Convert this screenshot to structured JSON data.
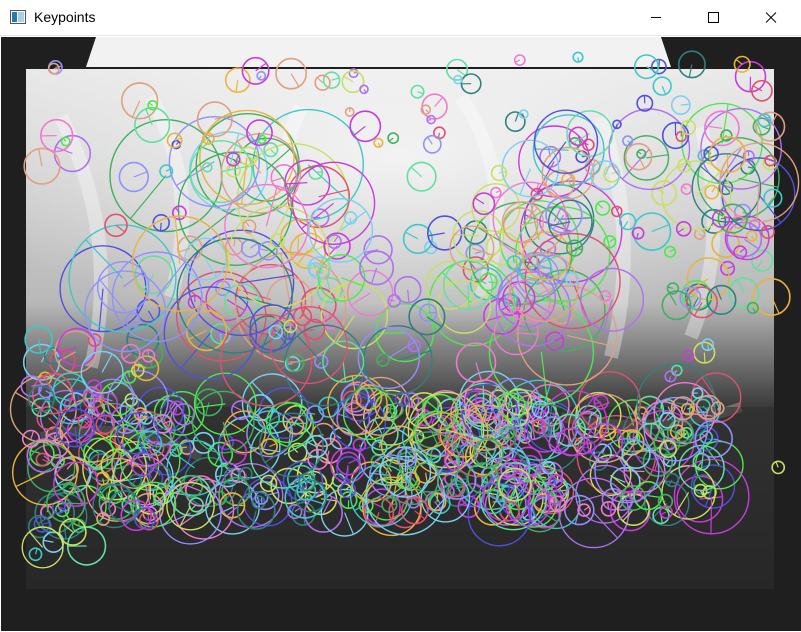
{
  "window": {
    "title": "Keypoints",
    "icon": "opencv-window-icon"
  },
  "controls": {
    "minimize_icon": "minimize-icon",
    "maximize_icon": "maximize-icon",
    "close_icon": "close-icon"
  },
  "colors": {
    "titlebar_bg": "#ffffff",
    "keypoint_palette": [
      "#4de84d",
      "#c83cdc",
      "#3cc8c8",
      "#e8b43c",
      "#5050e0",
      "#e05070",
      "#7ad0f0",
      "#b070f0",
      "#40b060",
      "#f07ad0",
      "#c8e060",
      "#308080",
      "#e0a080",
      "#9090ff",
      "#60e0a0"
    ]
  }
}
